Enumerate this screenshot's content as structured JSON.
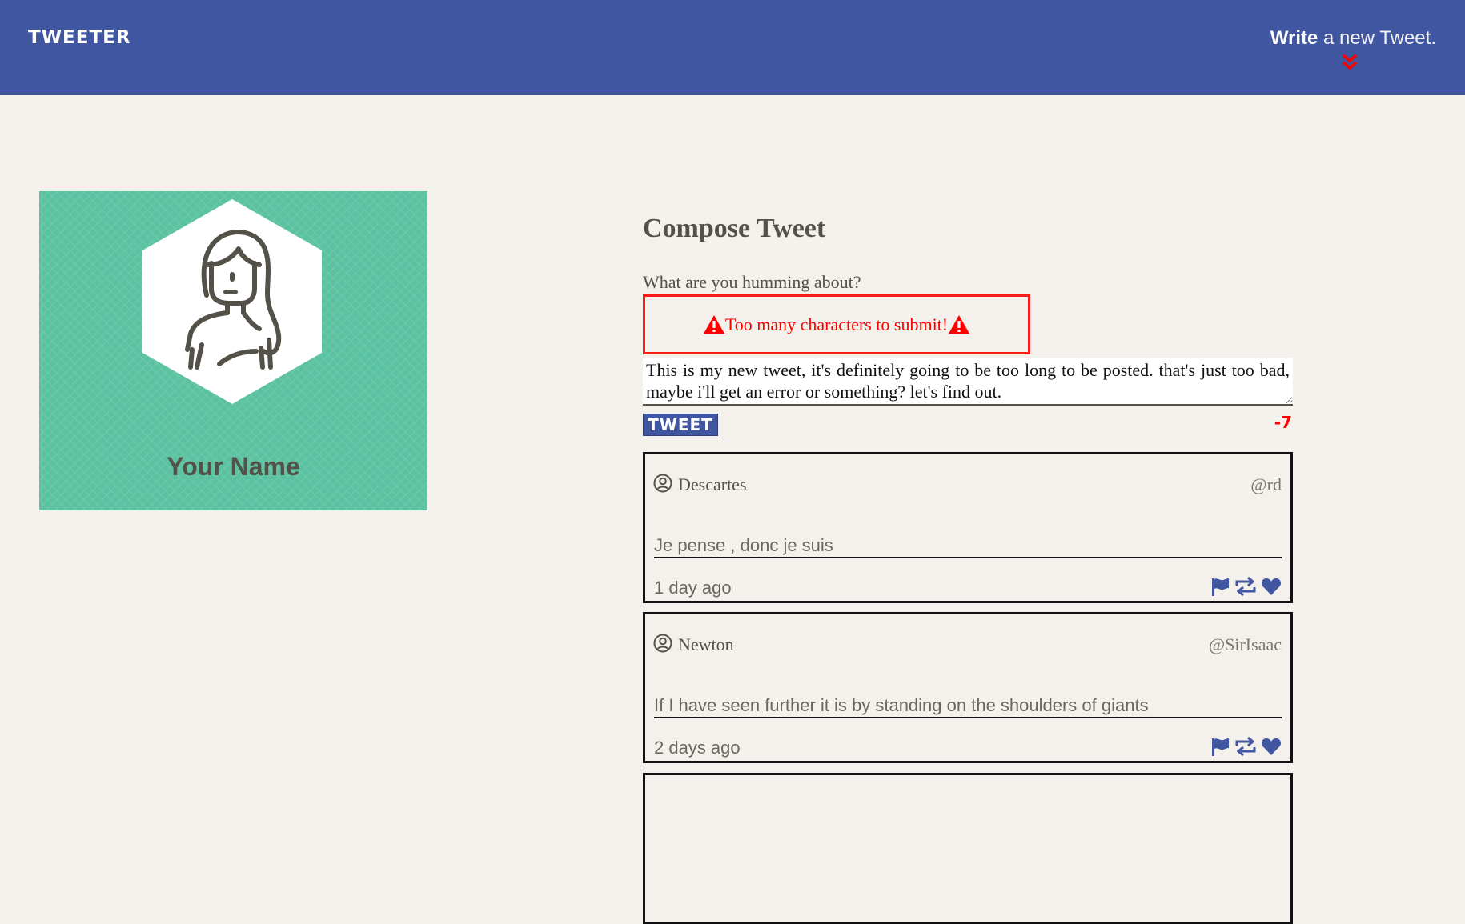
{
  "nav": {
    "logo": "TWEETER",
    "compose_bold": "Write",
    "compose_rest": " a new Tweet.",
    "chevron_icon": "double-chevron-down",
    "chevron_color": "#ff0000"
  },
  "profile": {
    "name": "Your Name",
    "avatar_icon": "woman-avatar-icon",
    "bg_color": "#5bc2a1"
  },
  "compose": {
    "title": "Compose Tweet",
    "label": "What are you humming about?",
    "error": "Too many characters to submit!",
    "error_icon": "warning-triangle-icon",
    "input_value": "This is my new tweet, it's definitely going to be too long to be posted. that's just too bad, maybe i'll get an error or something? let's find out.",
    "button_label": "TWEET",
    "counter": "-7",
    "error_color": "#ff0000"
  },
  "tweets": [
    {
      "name": "Descartes",
      "handle": "@rd",
      "content": "Je pense , donc je suis",
      "time": "1 day ago"
    },
    {
      "name": "Newton",
      "handle": "@SirIsaac",
      "content": "If I have seen further it is by standing on the shoulders of giants",
      "time": "2 days ago"
    }
  ],
  "colors": {
    "brand": "#4056a1",
    "background": "#f4f1ec",
    "text": "#545149"
  }
}
